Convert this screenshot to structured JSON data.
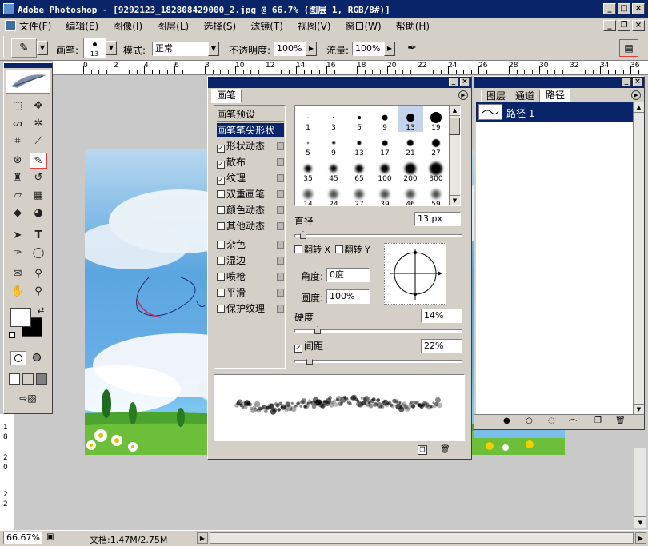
{
  "window": {
    "title": "Adobe Photoshop - [9292123_182808429000_2.jpg @ 66.7% (图层 1, RGB/8#)]"
  },
  "menu": [
    "文件(F)",
    "编辑(E)",
    "图像(I)",
    "图层(L)",
    "选择(S)",
    "滤镜(T)",
    "视图(V)",
    "窗口(W)",
    "帮助(H)"
  ],
  "options": {
    "brush_label": "画笔:",
    "brush_size": "13",
    "mode_label": "模式:",
    "mode_value": "正常",
    "opacity_label": "不透明度:",
    "opacity_value": "100%",
    "flow_label": "流量:",
    "flow_value": "100%"
  },
  "ruler_top": [
    "0",
    "2",
    "4",
    "6",
    "8",
    "10",
    "12",
    "14",
    "16",
    "18",
    "20",
    "22",
    "24",
    "26",
    "28",
    "30",
    "32",
    "34",
    "36"
  ],
  "ruler_left": [
    "1",
    "8",
    "2",
    "0",
    "2",
    "2"
  ],
  "brush_panel": {
    "title": "画笔",
    "presets_header": "画笔预设",
    "options": [
      {
        "label": "画笔笔尖形状",
        "checkbox": false,
        "checked": false,
        "selected": true,
        "lock": false
      },
      {
        "label": "形状动态",
        "checkbox": true,
        "checked": true,
        "lock": true
      },
      {
        "label": "散布",
        "checkbox": true,
        "checked": true,
        "lock": true
      },
      {
        "label": "纹理",
        "checkbox": true,
        "checked": true,
        "lock": true
      },
      {
        "label": "双重画笔",
        "checkbox": true,
        "checked": false,
        "lock": true
      },
      {
        "label": "颜色动态",
        "checkbox": true,
        "checked": false,
        "lock": true
      },
      {
        "label": "其他动态",
        "checkbox": true,
        "checked": false,
        "lock": true
      },
      {
        "label": "杂色",
        "checkbox": true,
        "checked": false,
        "lock": true
      },
      {
        "label": "湿边",
        "checkbox": true,
        "checked": false,
        "lock": true
      },
      {
        "label": "喷枪",
        "checkbox": true,
        "checked": false,
        "lock": true
      },
      {
        "label": "平滑",
        "checkbox": true,
        "checked": false,
        "lock": true
      },
      {
        "label": "保护纹理",
        "checkbox": true,
        "checked": false,
        "lock": true
      }
    ],
    "brush_sizes": [
      "1",
      "3",
      "5",
      "9",
      "13",
      "19",
      "5",
      "9",
      "13",
      "17",
      "21",
      "27",
      "35",
      "45",
      "65",
      "100",
      "200",
      "300",
      "14",
      "24",
      "27",
      "39",
      "46",
      "59"
    ],
    "diameter_label": "直径",
    "diameter_value": "13 px",
    "flip_x_label": "翻转 X",
    "flip_y_label": "翻转 Y",
    "angle_label": "角度:",
    "angle_value": "0度",
    "roundness_label": "圆度:",
    "roundness_value": "100%",
    "hardness_label": "硬度",
    "hardness_value": "14%",
    "spacing_label": "间距",
    "spacing_value": "22%"
  },
  "layers_panel": {
    "tabs": [
      "图层",
      "通道",
      "路径"
    ],
    "active_tab": 2,
    "paths": [
      {
        "name": "路径 1"
      }
    ]
  },
  "status": {
    "zoom": "66.67%",
    "doc": "文档:1.47M/2.75M"
  }
}
